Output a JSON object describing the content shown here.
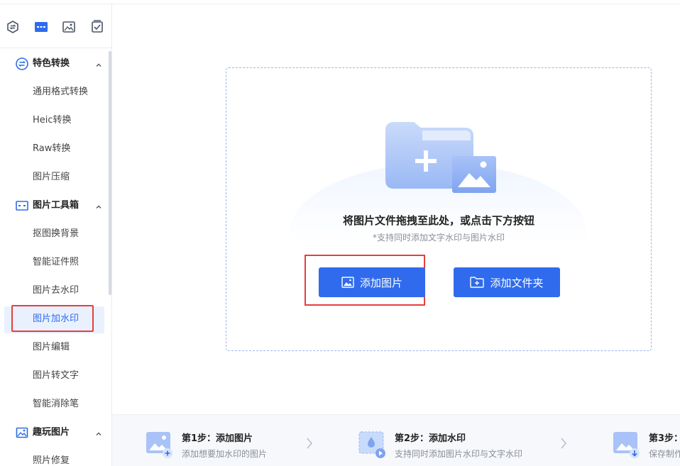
{
  "sidebar": {
    "icon_bar": [
      "convert-icon",
      "toolbox-icon",
      "image-fun-icon",
      "checklist-icon"
    ],
    "groups": [
      {
        "label": "特色转换",
        "icon": "convert-icon",
        "items": [
          "通用格式转换",
          "Heic转换",
          "Raw转换",
          "图片压缩"
        ]
      },
      {
        "label": "图片工具箱",
        "icon": "toolbox-icon",
        "items": [
          "抠图换背景",
          "智能证件照",
          "图片去水印",
          "图片加水印",
          "图片编辑",
          "图片转文字",
          "智能消除笔"
        ]
      },
      {
        "label": "趣玩图片",
        "icon": "image-fun-icon",
        "items": [
          "照片修复"
        ]
      }
    ],
    "active_item": "图片加水印"
  },
  "dropzone": {
    "title": "将图片文件拖拽至此处，或点击下方按钮",
    "subtitle": "*支持同时添加文字水印与图片水印",
    "add_image_label": "添加图片",
    "add_folder_label": "添加文件夹"
  },
  "steps": [
    {
      "title": "第1步：添加图片",
      "desc": "添加想要加水印的图片"
    },
    {
      "title": "第2步：添加水印",
      "desc": "支持同时添加图片水印与文字水印"
    },
    {
      "title": "第3步：",
      "desc": "保存制作"
    }
  ],
  "colors": {
    "accent": "#2f6bec",
    "highlight_border": "#e63e3e",
    "active_bg": "#eaf1fe"
  }
}
